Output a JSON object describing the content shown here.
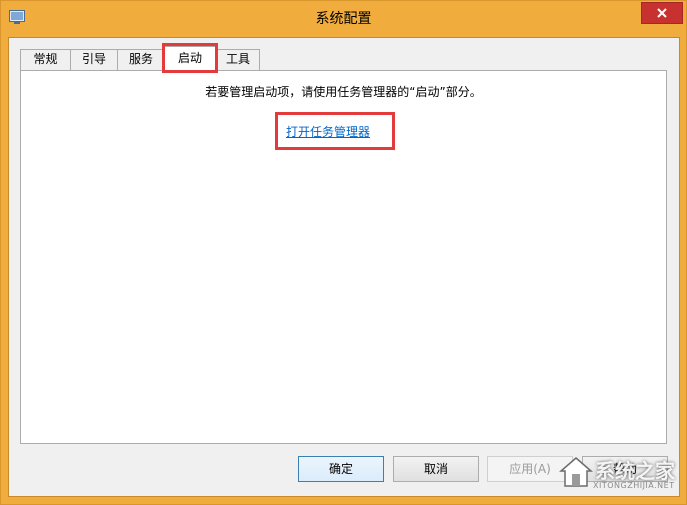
{
  "window": {
    "title": "系统配置",
    "icon": "msconfig-icon",
    "close_icon": "close-icon"
  },
  "tabs": [
    {
      "label": "常规",
      "active": false
    },
    {
      "label": "引导",
      "active": false
    },
    {
      "label": "服务",
      "active": false
    },
    {
      "label": "启动",
      "active": true
    },
    {
      "label": "工具",
      "active": false
    }
  ],
  "startup_panel": {
    "message": "若要管理启动项，请使用任务管理器的“启动”部分。",
    "link_label": "打开任务管理器"
  },
  "buttons": {
    "ok": "确定",
    "cancel": "取消",
    "apply": "应用(A)",
    "help": "帮助"
  },
  "watermark": {
    "text": "系统之家",
    "sub": "XITONGZHIJIA.NET"
  },
  "colors": {
    "frame": "#f0ac3c",
    "close_button": "#c7312f",
    "highlight_box": "#e33b3b",
    "link": "#0066cc"
  }
}
